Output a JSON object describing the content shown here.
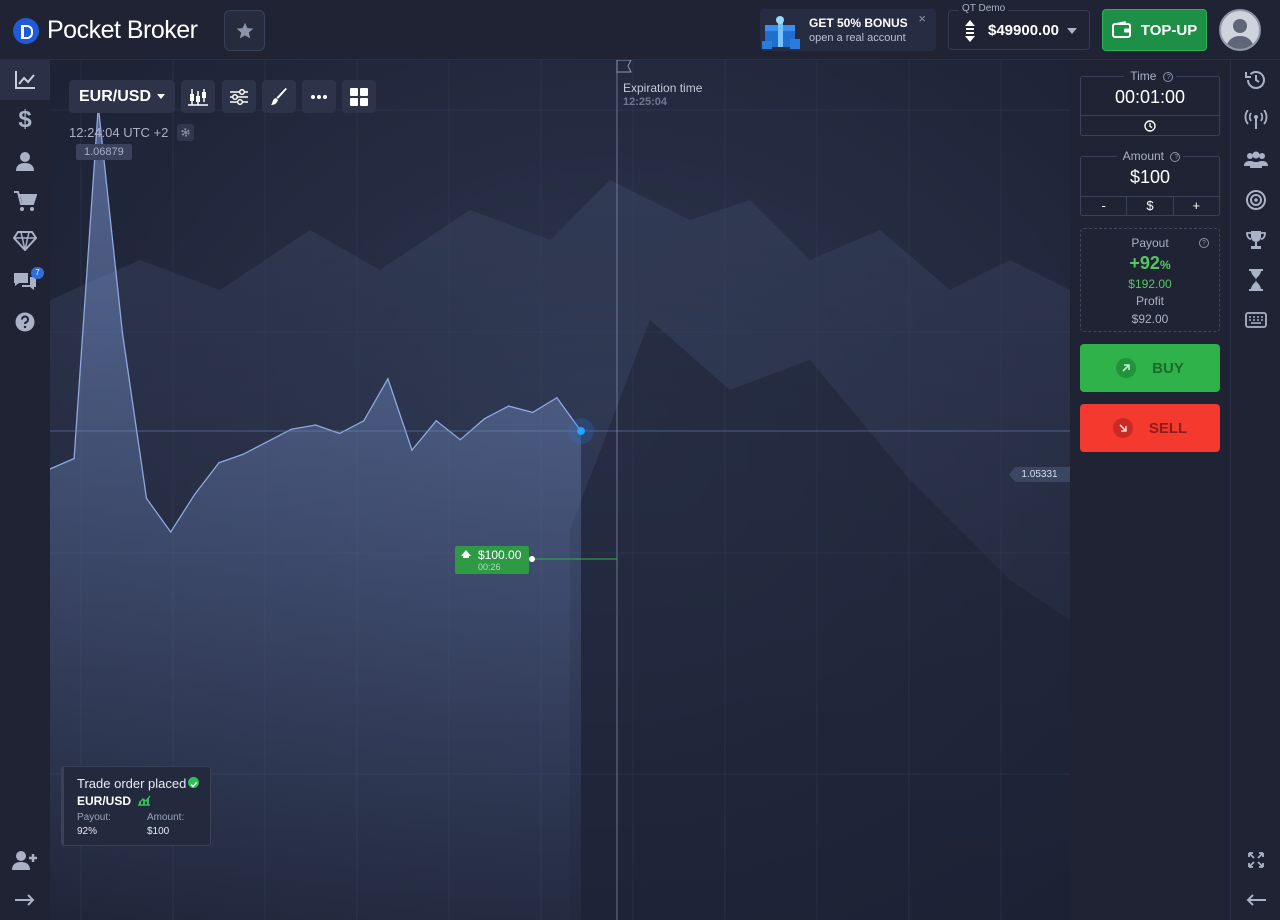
{
  "app": {
    "logo_text": "Pocket Broker"
  },
  "header": {
    "bonus_title": "GET 50% BONUS",
    "bonus_subtitle": "open a real account",
    "bonus_close": "×",
    "account_label": "QT Demo",
    "balance": "$49900.00",
    "topup_label": "TOP-UP"
  },
  "left_nav": {
    "chat_badge": "7",
    "items": [
      "chart-icon",
      "dollar-icon",
      "user-icon",
      "cart-icon",
      "diamond-icon",
      "chat-icon",
      "help-icon",
      "add-user-icon",
      "arrow-right-icon"
    ]
  },
  "chart": {
    "pair": "EUR/USD",
    "clock": "12:24:04 UTC +2",
    "max_price_label": "1.06879",
    "expiration_label": "Expiration time",
    "expiration_time": "12:25:04",
    "current_price": "1.05331",
    "trade_marker": {
      "amount": "$100.00",
      "timer": "00:26",
      "direction": "up"
    },
    "toast": {
      "title": "Trade order placed",
      "pair": "EUR/USD",
      "payout_label": "Payout:",
      "payout_value": "92%",
      "amount_label": "Amount:",
      "amount_value": "$100"
    }
  },
  "chart_data": {
    "type": "area",
    "series": [
      {
        "values": [
          1.0515,
          1.052,
          1.06879,
          1.058,
          1.0501,
          1.0485,
          1.0503,
          1.0518,
          1.0522,
          1.0528,
          1.0534,
          1.0536,
          1.0532,
          1.0538,
          1.0558,
          1.0524,
          1.0538,
          1.0529,
          1.0539,
          1.0545,
          1.0542,
          1.0549,
          1.05331
        ]
      }
    ],
    "current_value": 1.05331,
    "ylim": [
      1.03,
      1.071
    ]
  },
  "panel": {
    "time_label": "Time",
    "time_value": "00:01:00",
    "amount_label": "Amount",
    "amount_value": "$100",
    "minus": "-",
    "currency": "$",
    "plus": "+",
    "payout_label": "Payout",
    "payout_pct": "+92",
    "payout_pct_sign": "%",
    "payout_amount": "$192.00",
    "profit_label": "Profit",
    "profit_value": "$92.00",
    "buy_label": "BUY",
    "sell_label": "SELL"
  },
  "colors": {
    "accent_green": "#2fb24a",
    "accent_red": "#f4392e",
    "brand_blue": "#1f5bd8"
  }
}
